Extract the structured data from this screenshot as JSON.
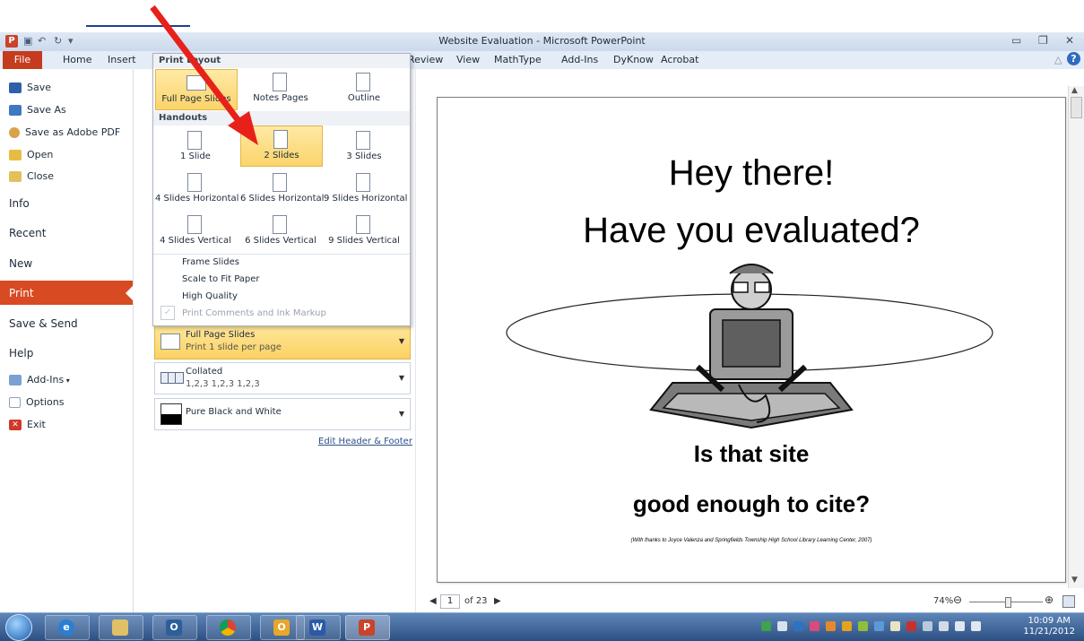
{
  "window": {
    "title": "Website Evaluation - Microsoft PowerPoint"
  },
  "tabs": {
    "file": "File",
    "home": "Home",
    "insert": "Insert",
    "review": "Review",
    "view": "View",
    "mathtype": "MathType",
    "addins": "Add-Ins",
    "dyknow": "DyKnow",
    "acrobat": "Acrobat"
  },
  "backstage": {
    "save": "Save",
    "save_as": "Save As",
    "save_pdf": "Save as Adobe PDF",
    "open": "Open",
    "close": "Close",
    "info": "Info",
    "recent": "Recent",
    "new": "New",
    "print": "Print",
    "save_send": "Save & Send",
    "help": "Help",
    "addins": "Add-Ins",
    "options": "Options",
    "exit": "Exit"
  },
  "print_layout": {
    "header": "Print Layout",
    "handouts_header": "Handouts",
    "options_top": [
      "Full Page Slides",
      "Notes Pages",
      "Outline"
    ],
    "handouts_row1": [
      "1 Slide",
      "2 Slides",
      "3 Slides"
    ],
    "handouts_row2": [
      "4 Slides Horizontal",
      "6 Slides Horizontal",
      "9 Slides Horizontal"
    ],
    "handouts_row3": [
      "4 Slides Vertical",
      "6 Slides Vertical",
      "9 Slides Vertical"
    ],
    "frame_slides": "Frame Slides",
    "scale_to_fit": "Scale to Fit Paper",
    "high_quality": "High Quality",
    "print_comments": "Print Comments and Ink Markup"
  },
  "settings": {
    "layout_title": "Full Page Slides",
    "layout_sub": "Print 1 slide per page",
    "collated_title": "Collated",
    "collated_sub": "1,2,3   1,2,3   1,2,3",
    "color_title": "Pure Black and White",
    "edit_header_footer": "Edit Header & Footer"
  },
  "slide": {
    "line1": "Hey there!",
    "line2": "Have you evaluated?",
    "line3": "Is that site",
    "line4": "good enough to cite?",
    "credit": "(With thanks to Joyce Valenza and Springfields Township High School Library Learning Center, 2007)"
  },
  "pager": {
    "current": "1",
    "total": "of 23"
  },
  "zoom": {
    "level": "74%"
  },
  "clock": {
    "time": "10:09 AM",
    "date": "11/21/2012"
  },
  "colors": {
    "file_tab": "#c43b1d",
    "print_selected": "#d84a22",
    "highlight": "#fbd46a",
    "arrow": "#e8201a"
  }
}
